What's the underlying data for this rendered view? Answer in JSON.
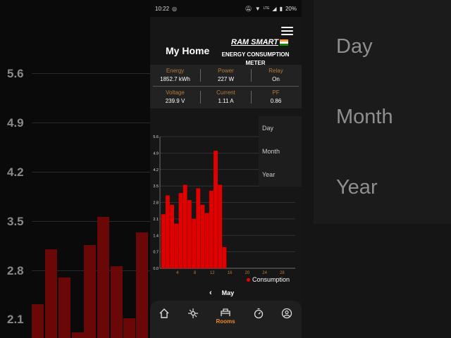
{
  "status_bar": {
    "time": "10:22",
    "battery": "20%",
    "network": "LTE"
  },
  "header": {
    "title": "My Home",
    "brand": "RAM SMART",
    "subtitle_line1": "ENERGY CONSUMPTION",
    "subtitle_line2": "METER"
  },
  "metrics": [
    {
      "label": "Energy",
      "value": "1852.7 kWh"
    },
    {
      "label": "Power",
      "value": "227 W"
    },
    {
      "label": "Relay",
      "value": "On"
    },
    {
      "label": "Voltage",
      "value": "239.9 V"
    },
    {
      "label": "Current",
      "value": "1.11 A"
    },
    {
      "label": "PF",
      "value": "0.86"
    }
  ],
  "period_menu": {
    "items": [
      "Day",
      "Month",
      "Year"
    ]
  },
  "nav": {
    "month": "May",
    "prev_icon": "chevron-left-icon"
  },
  "bottom_nav": {
    "active": "Rooms",
    "items": [
      "home-icon",
      "devices-icon",
      "rooms-icon",
      "timer-icon",
      "profile-icon"
    ]
  },
  "colors": {
    "accent": "#f08a24",
    "bar": "#e00000",
    "label": "#b77a38"
  },
  "chart_data": {
    "type": "bar",
    "title": "",
    "xlabel": "",
    "ylabel": "",
    "ylim": [
      0,
      5.6
    ],
    "yticks": [
      "0.0",
      "0.7",
      "1.4",
      "2.1",
      "2.8",
      "3.5",
      "4.2",
      "4.9",
      "5.6"
    ],
    "xlim": [
      0,
      31
    ],
    "xticks": [
      "4",
      "8",
      "12",
      "16",
      "20",
      "24",
      "28"
    ],
    "grid": true,
    "legend": "bottom-right",
    "series": [
      {
        "name": "Consumption",
        "x": [
          1,
          2,
          3,
          4,
          5,
          6,
          7,
          8,
          9,
          10,
          11,
          12,
          13,
          14,
          15
        ],
        "values": [
          2.3,
          3.1,
          2.7,
          1.9,
          3.2,
          3.55,
          2.9,
          2.1,
          3.4,
          2.7,
          2.35,
          3.3,
          5.0,
          3.55,
          0.9
        ]
      }
    ]
  },
  "background_menu": {
    "items": [
      "Day",
      "Month",
      "Year"
    ]
  },
  "background_yticks": [
    "5.6",
    "4.9",
    "4.2",
    "3.5",
    "2.8",
    "2.1"
  ]
}
